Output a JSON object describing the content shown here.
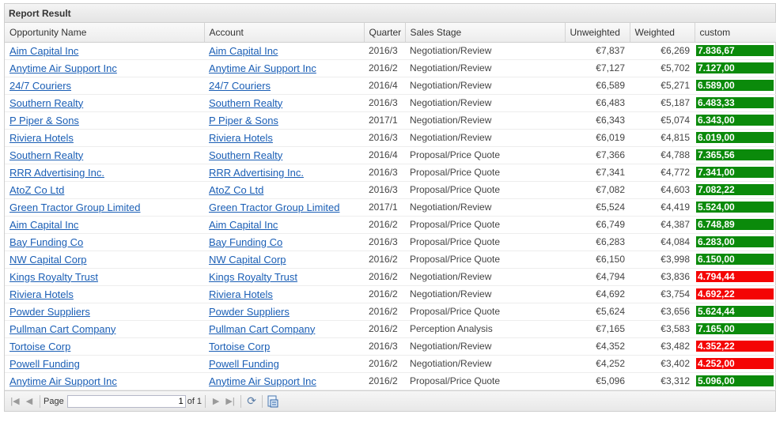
{
  "panel": {
    "title": "Report Result"
  },
  "columns": [
    "Opportunity Name",
    "Account",
    "Quarter",
    "Sales Stage",
    "Unweighted",
    "Weighted",
    "custom"
  ],
  "rows": [
    {
      "opportunity": "Aim Capital Inc",
      "account": "Aim Capital Inc",
      "quarter": "2016/3",
      "stage": "Negotiation/Review",
      "unweighted": "€7,837",
      "weighted": "€6,269",
      "custom": "7.836,67",
      "status": "green"
    },
    {
      "opportunity": "Anytime Air Support Inc",
      "account": "Anytime Air Support Inc",
      "quarter": "2016/2",
      "stage": "Negotiation/Review",
      "unweighted": "€7,127",
      "weighted": "€5,702",
      "custom": "7.127,00",
      "status": "green"
    },
    {
      "opportunity": "24/7 Couriers",
      "account": "24/7 Couriers",
      "quarter": "2016/4",
      "stage": "Negotiation/Review",
      "unweighted": "€6,589",
      "weighted": "€5,271",
      "custom": "6.589,00",
      "status": "green"
    },
    {
      "opportunity": "Southern Realty",
      "account": "Southern Realty",
      "quarter": "2016/3",
      "stage": "Negotiation/Review",
      "unweighted": "€6,483",
      "weighted": "€5,187",
      "custom": "6.483,33",
      "status": "green"
    },
    {
      "opportunity": "P Piper & Sons",
      "account": "P Piper & Sons",
      "quarter": "2017/1",
      "stage": "Negotiation/Review",
      "unweighted": "€6,343",
      "weighted": "€5,074",
      "custom": "6.343,00",
      "status": "green"
    },
    {
      "opportunity": "Riviera Hotels",
      "account": "Riviera Hotels",
      "quarter": "2016/3",
      "stage": "Negotiation/Review",
      "unweighted": "€6,019",
      "weighted": "€4,815",
      "custom": "6.019,00",
      "status": "green"
    },
    {
      "opportunity": "Southern Realty",
      "account": "Southern Realty",
      "quarter": "2016/4",
      "stage": "Proposal/Price Quote",
      "unweighted": "€7,366",
      "weighted": "€4,788",
      "custom": "7.365,56",
      "status": "green"
    },
    {
      "opportunity": "RRR Advertising Inc.",
      "account": "RRR Advertising Inc.",
      "quarter": "2016/3",
      "stage": "Proposal/Price Quote",
      "unweighted": "€7,341",
      "weighted": "€4,772",
      "custom": "7.341,00",
      "status": "green"
    },
    {
      "opportunity": "AtoZ Co Ltd",
      "account": "AtoZ Co Ltd",
      "quarter": "2016/3",
      "stage": "Proposal/Price Quote",
      "unweighted": "€7,082",
      "weighted": "€4,603",
      "custom": "7.082,22",
      "status": "green"
    },
    {
      "opportunity": "Green Tractor Group Limited",
      "account": "Green Tractor Group Limited",
      "quarter": "2017/1",
      "stage": "Negotiation/Review",
      "unweighted": "€5,524",
      "weighted": "€4,419",
      "custom": "5.524,00",
      "status": "green"
    },
    {
      "opportunity": "Aim Capital Inc",
      "account": "Aim Capital Inc",
      "quarter": "2016/2",
      "stage": "Proposal/Price Quote",
      "unweighted": "€6,749",
      "weighted": "€4,387",
      "custom": "6.748,89",
      "status": "green"
    },
    {
      "opportunity": "Bay Funding Co",
      "account": "Bay Funding Co",
      "quarter": "2016/3",
      "stage": "Proposal/Price Quote",
      "unweighted": "€6,283",
      "weighted": "€4,084",
      "custom": "6.283,00",
      "status": "green"
    },
    {
      "opportunity": "NW Capital Corp",
      "account": "NW Capital Corp",
      "quarter": "2016/2",
      "stage": "Proposal/Price Quote",
      "unweighted": "€6,150",
      "weighted": "€3,998",
      "custom": "6.150,00",
      "status": "green"
    },
    {
      "opportunity": "Kings Royalty Trust",
      "account": "Kings Royalty Trust",
      "quarter": "2016/2",
      "stage": "Negotiation/Review",
      "unweighted": "€4,794",
      "weighted": "€3,836",
      "custom": "4.794,44",
      "status": "red"
    },
    {
      "opportunity": "Riviera Hotels",
      "account": "Riviera Hotels",
      "quarter": "2016/2",
      "stage": "Negotiation/Review",
      "unweighted": "€4,692",
      "weighted": "€3,754",
      "custom": "4.692,22",
      "status": "red"
    },
    {
      "opportunity": "Powder Suppliers",
      "account": "Powder Suppliers",
      "quarter": "2016/2",
      "stage": "Proposal/Price Quote",
      "unweighted": "€5,624",
      "weighted": "€3,656",
      "custom": "5.624,44",
      "status": "green"
    },
    {
      "opportunity": "Pullman Cart Company",
      "account": "Pullman Cart Company",
      "quarter": "2016/2",
      "stage": "Perception Analysis",
      "unweighted": "€7,165",
      "weighted": "€3,583",
      "custom": "7.165,00",
      "status": "green"
    },
    {
      "opportunity": "Tortoise Corp",
      "account": "Tortoise Corp",
      "quarter": "2016/3",
      "stage": "Negotiation/Review",
      "unweighted": "€4,352",
      "weighted": "€3,482",
      "custom": "4.352,22",
      "status": "red"
    },
    {
      "opportunity": "Powell Funding",
      "account": "Powell Funding",
      "quarter": "2016/2",
      "stage": "Negotiation/Review",
      "unweighted": "€4,252",
      "weighted": "€3,402",
      "custom": "4.252,00",
      "status": "red"
    },
    {
      "opportunity": "Anytime Air Support Inc",
      "account": "Anytime Air Support Inc",
      "quarter": "2016/2",
      "stage": "Proposal/Price Quote",
      "unweighted": "€5,096",
      "weighted": "€3,312",
      "custom": "5.096,00",
      "status": "green"
    }
  ],
  "pager": {
    "page_label": "Page",
    "page_value": "1",
    "of_label": "of 1"
  },
  "colors": {
    "link": "#1a5eb5",
    "good": "#0b8a0b",
    "bad": "#f40505"
  }
}
